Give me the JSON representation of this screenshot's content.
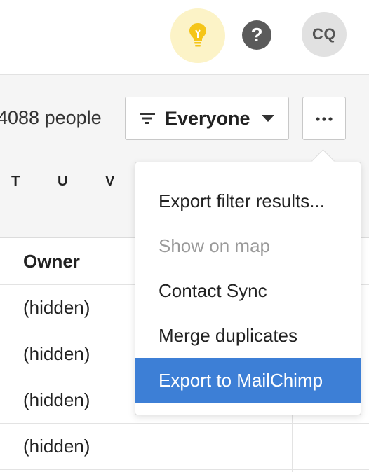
{
  "header": {
    "avatar_initials": "CQ",
    "help_symbol": "?",
    "icons": [
      "lightbulb-icon",
      "help-icon"
    ],
    "bulb_color": "#f5c518",
    "bulb_bg": "#fcf3c7"
  },
  "toolbar": {
    "people_count": "4088 people",
    "filter_label": "Everyone",
    "filter_icon": "filter-lines-icon",
    "caret_icon": "caret-down-icon",
    "more_icon": "ellipsis-icon",
    "alphabet": [
      "T",
      "U",
      "V"
    ]
  },
  "table": {
    "column_header": "Owner",
    "rows": [
      "(hidden)",
      "(hidden)",
      "(hidden)",
      "(hidden)"
    ]
  },
  "menu": {
    "items": [
      {
        "label": "Export filter results...",
        "state": "normal"
      },
      {
        "label": "Show on map",
        "state": "disabled"
      },
      {
        "label": "Contact Sync",
        "state": "normal"
      },
      {
        "label": "Merge duplicates",
        "state": "normal"
      },
      {
        "label": "Export to MailChimp",
        "state": "highlighted"
      }
    ],
    "highlight_color": "#3d7fd6"
  }
}
